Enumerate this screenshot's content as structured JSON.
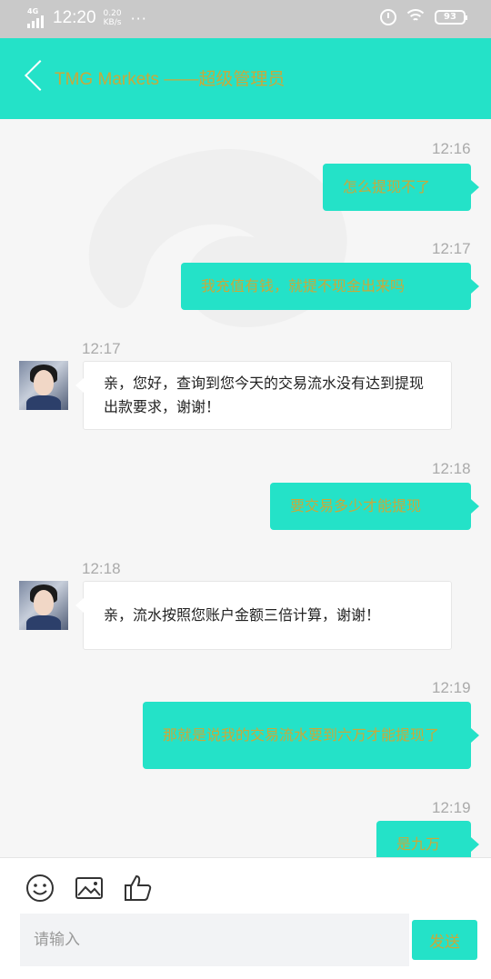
{
  "status_bar": {
    "network": "4G",
    "time": "12:20",
    "speed_value": "0.20",
    "speed_unit": "KB/s",
    "more": "···",
    "battery": "93"
  },
  "header": {
    "title": "TMG Markets ——超级管理员"
  },
  "messages": [
    {
      "time": "12:16",
      "text": "怎么提现不了"
    },
    {
      "time": "12:17",
      "text": "我充值有钱，就提不现金出来吗"
    },
    {
      "time": "12:17",
      "text": "亲，您好，查询到您今天的交易流水没有达到提现出款要求，谢谢！"
    },
    {
      "time": "12:18",
      "text": "要交易多少才能提现"
    },
    {
      "time": "12:18",
      "text": "亲，流水按照您账户金额三倍计算，谢谢！"
    },
    {
      "time": "12:19",
      "text": "那就是说我的交易流水要到六万才能提现了"
    },
    {
      "time": "12:19",
      "text": "是九万"
    }
  ],
  "input": {
    "placeholder": "请输入",
    "send_label": "发送"
  },
  "colors": {
    "accent": "#24e2c8",
    "accent_text": "#c9a93a",
    "status_bar": "#c9c9c9",
    "chat_bg": "#f6f6f6"
  },
  "icons": [
    "back-arrow-icon",
    "signal-icon",
    "alarm-icon",
    "wifi-icon",
    "battery-icon",
    "smiley-icon",
    "image-icon",
    "thumbs-up-icon",
    "avatar"
  ]
}
